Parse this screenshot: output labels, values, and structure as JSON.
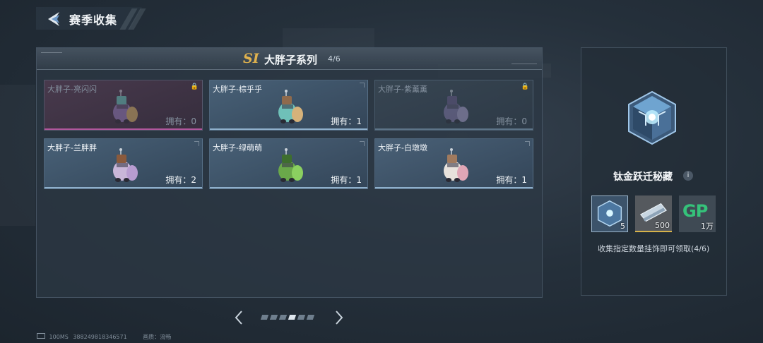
{
  "header": {
    "title": "赛季收集"
  },
  "panel": {
    "badge": "SI",
    "title": "大胖子系列",
    "count": "4/6"
  },
  "cards": [
    {
      "name": "大胖子-亮闪闪",
      "own": "拥有：0",
      "locked": true,
      "body": "#9c84c8",
      "accent": "#e6c36a",
      "head": "#66d6c8"
    },
    {
      "name": "大胖子-棕乎乎",
      "own": "拥有：1",
      "locked": false,
      "body": "#6fc0b8",
      "accent": "#d6b27a",
      "head": "#8f6a4c"
    },
    {
      "name": "大胖子-紫薰薰",
      "own": "拥有：0",
      "locked": true,
      "body": "#8a7bb0",
      "accent": "#b6a8d8",
      "head": "#6a5a8a"
    },
    {
      "name": "大胖子-兰胖胖",
      "own": "拥有：2",
      "locked": false,
      "body": "#c9b6d8",
      "accent": "#b89cd0",
      "head": "#8a5a3c"
    },
    {
      "name": "大胖子-绿萌萌",
      "own": "拥有：1",
      "locked": false,
      "body": "#6aa84a",
      "accent": "#8bd060",
      "head": "#3e6e2e"
    },
    {
      "name": "大胖子-白墩墩",
      "own": "拥有：1",
      "locked": false,
      "body": "#e8e2dc",
      "accent": "#e0a6b6",
      "head": "#a07a5e"
    }
  ],
  "pager": {
    "total": 6,
    "active": 4
  },
  "footer": {
    "ping": "100MS",
    "uid": "388249818346571",
    "quality_label": "画质：流畅"
  },
  "reward": {
    "name": "钛金跃迁秘藏",
    "info": "i",
    "items": [
      {
        "qty": "5",
        "icon": "titanium-crate-icon"
      },
      {
        "qty": "500",
        "icon": "ticket-icon"
      },
      {
        "qty": "1万",
        "icon": "gp-currency-icon",
        "glyph": "GP"
      }
    ],
    "caption": "收集指定数量挂饰即可领取(4/6)"
  },
  "colors": {
    "accent_gold": "#e0b24e",
    "locked_pink": "#b0579c",
    "gp_green": "#35c27a"
  }
}
